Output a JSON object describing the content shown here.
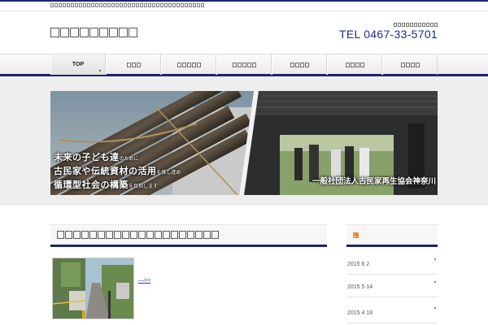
{
  "header": {
    "tel": "TEL 0467-33-5701"
  },
  "nav": {
    "top_label": "TOP"
  },
  "banner": {
    "copy_line1_big": "未来の子ども達",
    "copy_line1_small": "のために",
    "copy_line2_big": "古民家や伝統資材の活用",
    "copy_line2_small": "を推し進め",
    "copy_line3_big": "循環型社会の構築",
    "copy_line3_small": "を目指します",
    "organization": "一般社団法人古民家再生協会神奈川"
  },
  "post": {
    "more_link": "—>>"
  },
  "sidebar": {
    "entries": [
      {
        "date": "2015 6 2"
      },
      {
        "date": "2015 5 14"
      },
      {
        "date": "2015 4 18"
      }
    ]
  },
  "colors": {
    "accent": "#1c2470",
    "tel": "#1f2b8c",
    "link": "#2a3aa8",
    "rss": "#f08a24"
  }
}
